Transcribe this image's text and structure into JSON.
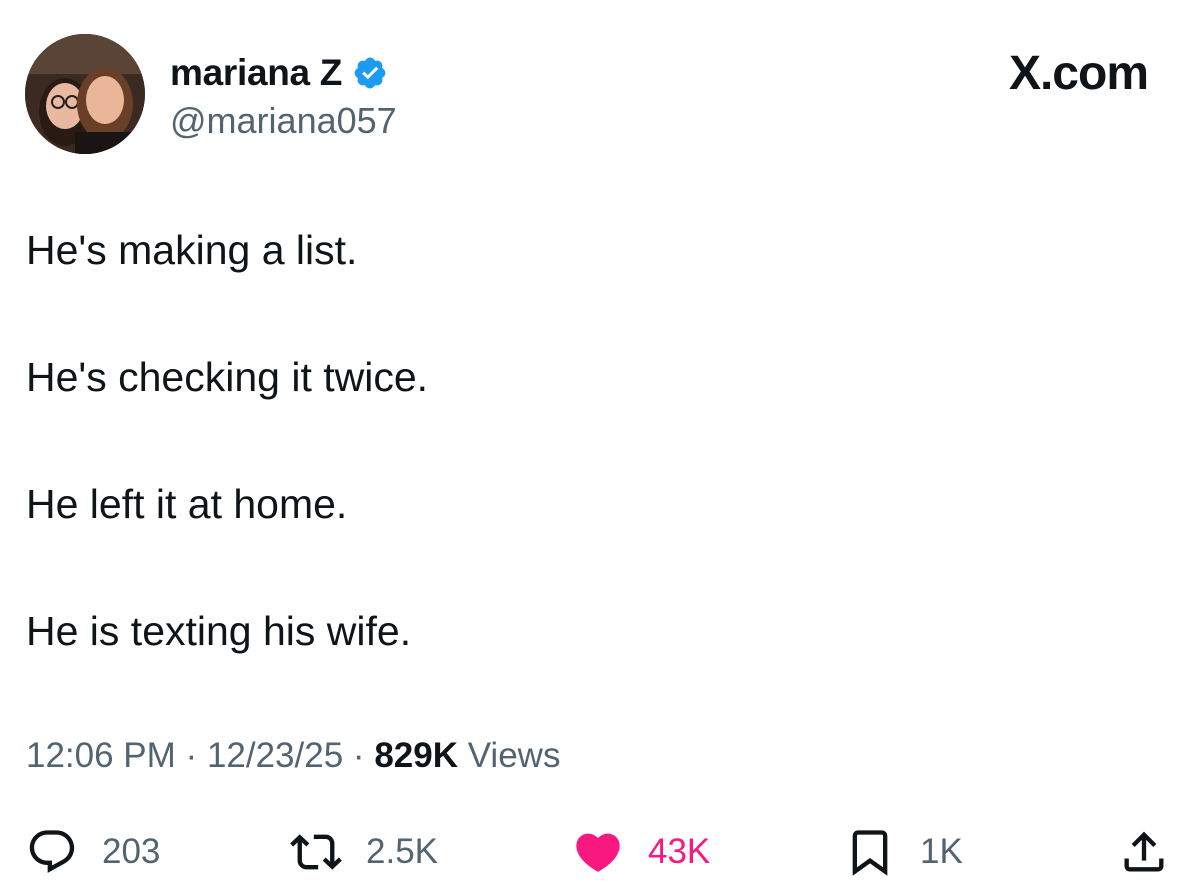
{
  "author": {
    "display_name": "mariana Z",
    "handle": "@mariana057",
    "verified": true,
    "avatar_icon": "profile-photo"
  },
  "brand": {
    "label": "X.com"
  },
  "tweet": {
    "lines": [
      "He's making a list.",
      "He's checking it twice.",
      "He left it at home.",
      "He is texting his wife."
    ],
    "time": "12:06 PM",
    "separator": "·",
    "date": "12/23/25",
    "views_count": "829K",
    "views_label": "Views"
  },
  "actions": {
    "replies": "203",
    "reposts": "2.5K",
    "likes": "43K",
    "bookmarks": "1K"
  },
  "colors": {
    "text": "#0f1419",
    "muted": "#536471",
    "verified": "#1d9bf0",
    "like": "#f91880"
  },
  "icons": {
    "reply": "reply-icon",
    "repost": "repost-icon",
    "like": "heart-icon",
    "bookmark": "bookmark-icon",
    "share": "share-icon",
    "verified": "verified-badge-icon"
  }
}
